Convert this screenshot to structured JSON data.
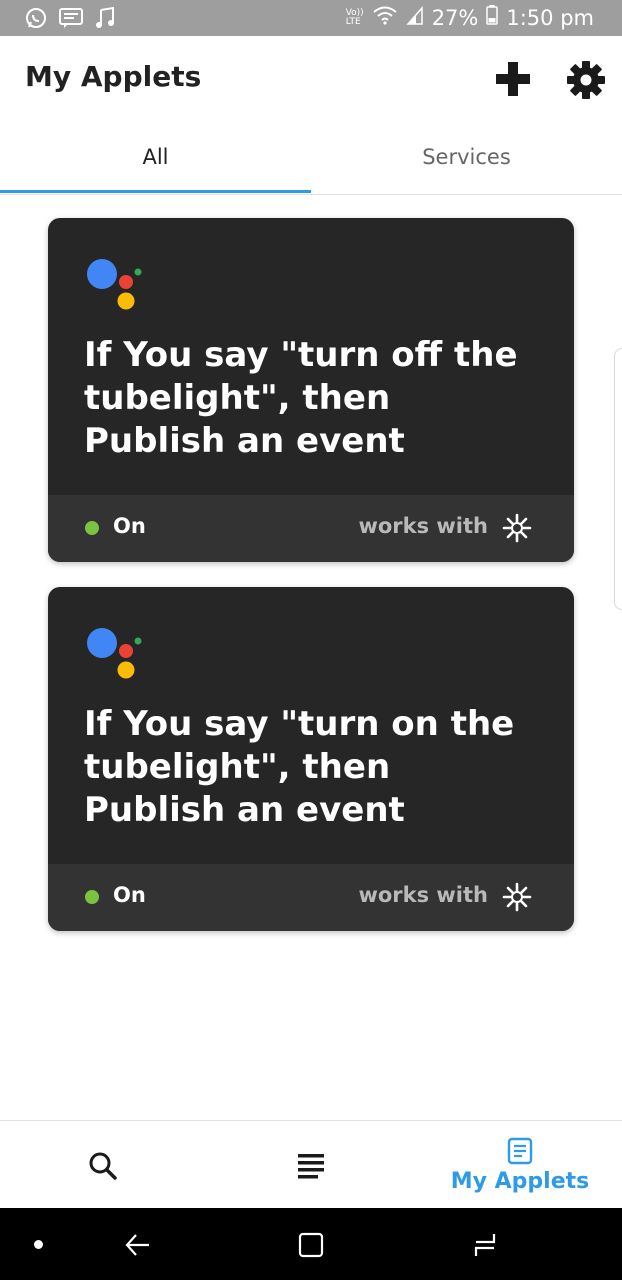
{
  "status_bar": {
    "volte": "Vo))\nLTE",
    "battery_percent": "27%",
    "time": "1:50 pm",
    "icons": [
      "whatsapp-icon",
      "message-icon",
      "music-icon",
      "volte-icon",
      "wifi-icon",
      "signal-icon",
      "battery-icon"
    ]
  },
  "header": {
    "title": "My Applets",
    "icons": [
      "plus-icon",
      "gear-icon"
    ]
  },
  "tabs": [
    {
      "label": "All",
      "active": true
    },
    {
      "label": "Services",
      "active": false
    }
  ],
  "applets": [
    {
      "title": "If You say \"turn off the tubelight\", then Publish an event",
      "status": "On",
      "works_with": "works with",
      "service_icon": "google-assistant-icon",
      "partner_icon": "webhook-icon"
    },
    {
      "title": "If You say \"turn on the tubelight\", then Publish an event",
      "status": "On",
      "works_with": "works with",
      "service_icon": "google-assistant-icon",
      "partner_icon": "webhook-icon"
    }
  ],
  "bottom_nav": {
    "items": [
      {
        "icon": "search-icon",
        "label": ""
      },
      {
        "icon": "feed-icon",
        "label": ""
      },
      {
        "icon": "my-applets-icon",
        "label": "My Applets",
        "active": true
      }
    ]
  },
  "colors": {
    "accent": "#2f9be8",
    "card_bg": "#262626",
    "card_footer_bg": "#333333",
    "status_on": "#7cc242",
    "status_bar_bg": "#9e9e9e"
  }
}
